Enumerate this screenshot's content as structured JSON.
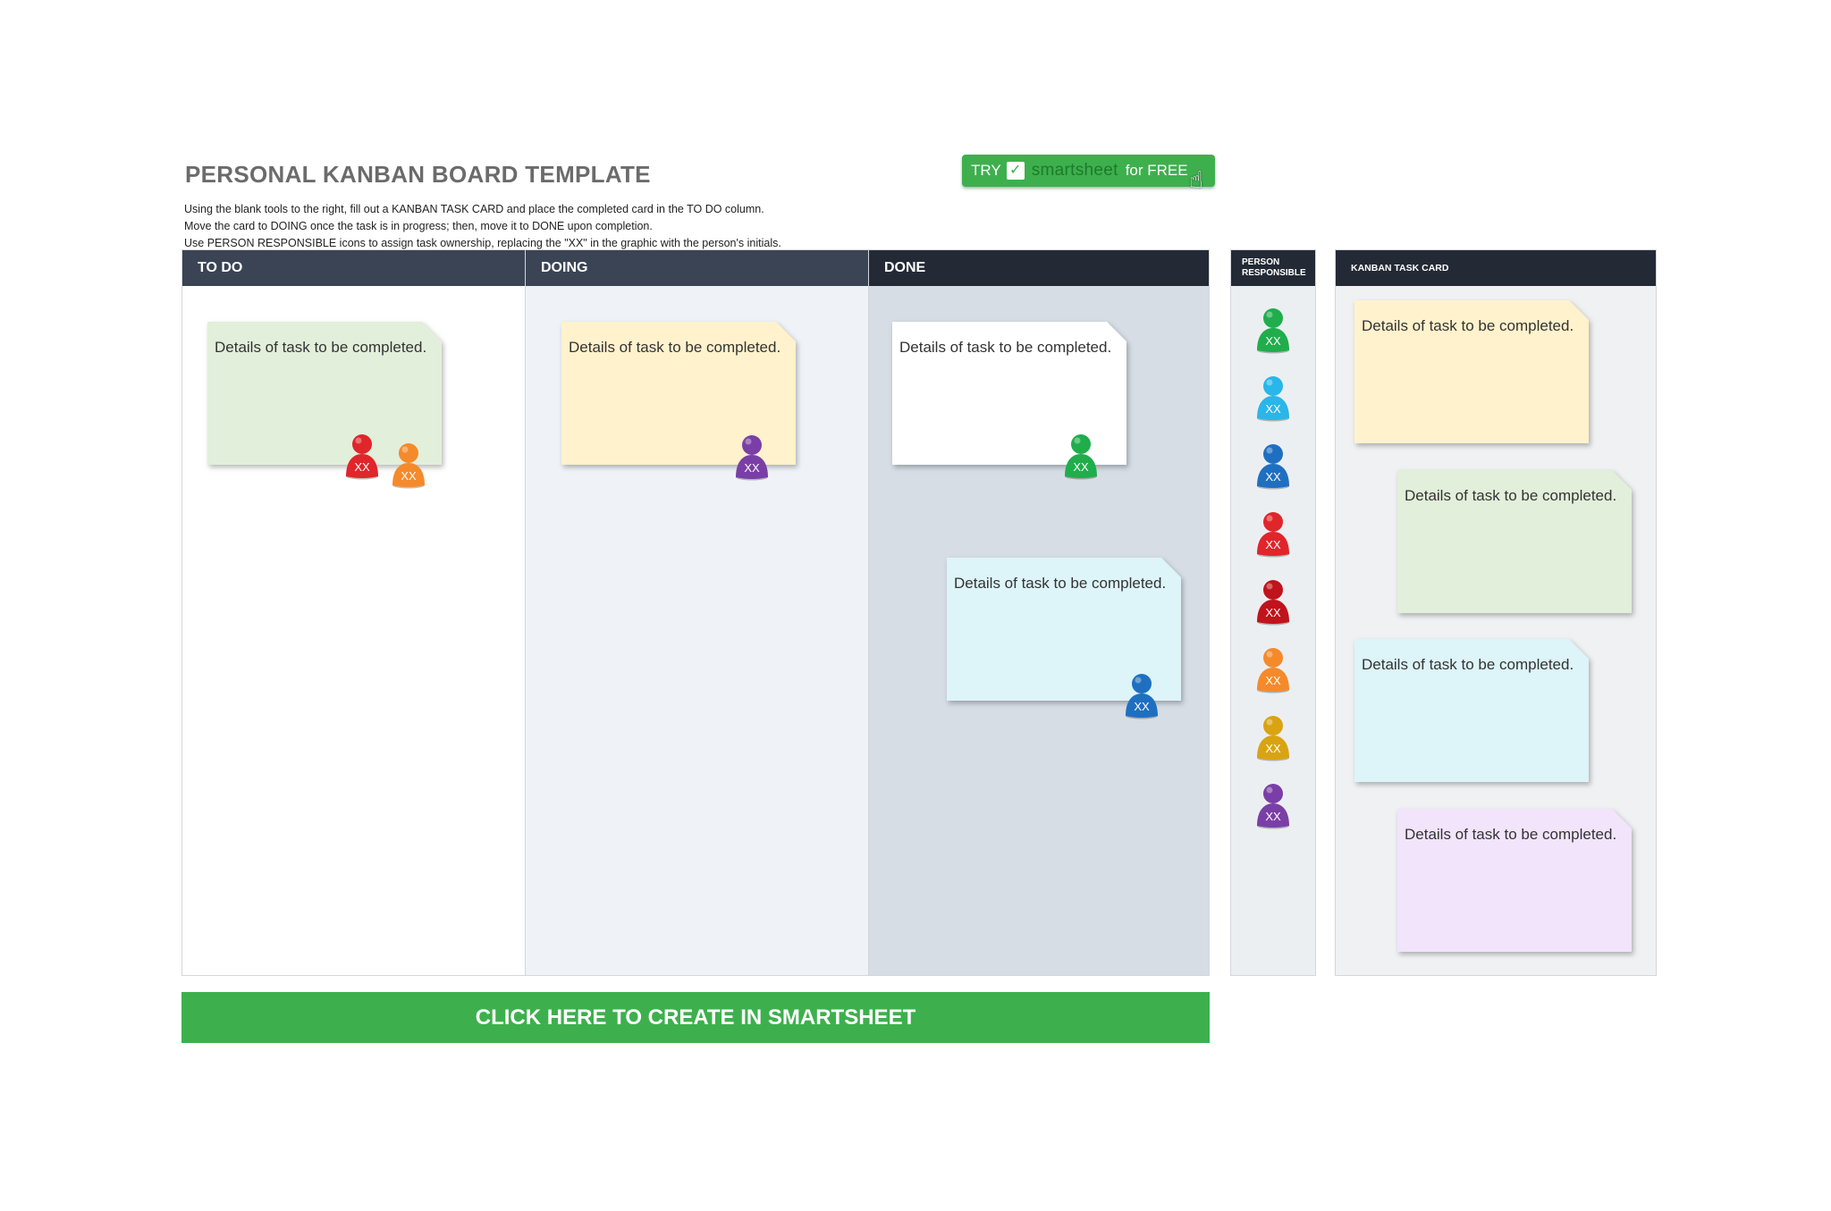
{
  "header": {
    "title": "PERSONAL KANBAN BOARD TEMPLATE",
    "instructions": [
      "Using the blank tools to the right, fill out a KANBAN TASK CARD and place the completed card in the TO DO column.",
      "Move the card to DOING once the task is in progress; then, move it to DONE upon completion.",
      "Use PERSON RESPONSIBLE icons to assign task ownership, replacing the \"XX\" in the graphic with the person's initials."
    ],
    "try_button": {
      "prefix": "TRY",
      "brand": "smartsheet",
      "suffix": "for FREE"
    }
  },
  "columns": {
    "todo": "TO DO",
    "doing": "DOING",
    "done": "DONE",
    "person_responsible": "PERSON RESPONSIBLE",
    "kanban_task_card": "KANBAN TASK CARD"
  },
  "card_text": "Details of task to be completed.",
  "pawn_initials": "XX",
  "colors": {
    "green": "#1fae4b",
    "cyan": "#29b6e8",
    "blue": "#1f6fc1",
    "red": "#e0252b",
    "dark_red": "#c0131b",
    "orange": "#f58a2b",
    "gold": "#d9a312",
    "purple": "#7a3fa6",
    "card_green": "#e2efda",
    "card_yellow": "#fff2cc",
    "card_white": "#ffffff",
    "card_cyan": "#ddf4f8",
    "card_lavender": "#f1e4fb",
    "cta": "#3db04d"
  },
  "cta": {
    "label": "CLICK HERE TO CREATE IN SMARTSHEET"
  }
}
